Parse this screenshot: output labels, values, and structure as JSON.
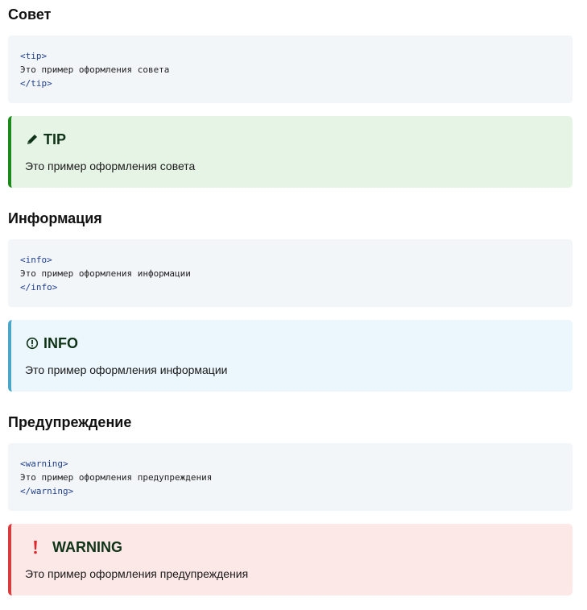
{
  "sections": [
    {
      "heading": "Совет",
      "code": {
        "open_tag": "<tip>",
        "text": "Это пример оформления совета",
        "close_tag": "</tip>"
      },
      "callout": {
        "icon": "pencil-icon",
        "title": "TIP",
        "body": "Это пример оформления совета",
        "accent_color": "#1b8a1b",
        "background": "#e6f4e6"
      }
    },
    {
      "heading": "Информация",
      "code": {
        "open_tag": "<info>",
        "text": "Это пример оформления информации",
        "close_tag": "</info>"
      },
      "callout": {
        "icon": "info-circle-icon",
        "title": "INFO",
        "body": "Это пример оформления информации",
        "accent_color": "#4aa7c9",
        "background": "#ebf6fd"
      }
    },
    {
      "heading": "Предупреждение",
      "code": {
        "open_tag": "<warning>",
        "text": "Это пример оформления предупреждения",
        "close_tag": "</warning>"
      },
      "callout": {
        "icon": "exclamation-icon",
        "title": "WARNING",
        "body": "Это пример оформления предупреждения",
        "accent_color": "#d83c3c",
        "background": "#fde8e8"
      }
    }
  ]
}
